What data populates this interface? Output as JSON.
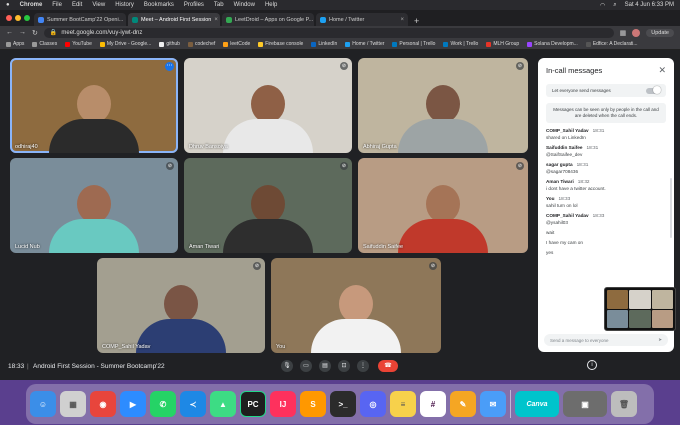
{
  "menubar": {
    "items": [
      "Chrome",
      "File",
      "Edit",
      "View",
      "History",
      "Bookmarks",
      "Profiles",
      "Tab",
      "Window",
      "Help"
    ],
    "clock": "Sat 4 Jun 6:33 PM"
  },
  "tabs": [
    {
      "label": "Summer BootCamp'22 Openi...",
      "color": "#4285f4"
    },
    {
      "label": "Meet – Android First Session",
      "color": "#00897b"
    },
    {
      "label": "LeetDroid – Apps on Google P...",
      "color": "#34a853"
    },
    {
      "label": "Home / Twitter",
      "color": "#1da1f2"
    }
  ],
  "address": {
    "url": "meet.google.com/vuy-iywt-dnz",
    "update_label": "Update"
  },
  "bookmarks": [
    "Apps",
    "Classes",
    "YouTube",
    "My Drive - Google...",
    "github",
    "codechef",
    "leetCode",
    "Firebase console",
    "LinkedIn",
    "Home / Twitter",
    "Personal | Trello",
    "Work | Trello",
    "MLH Group",
    "Solana Developm...",
    "Edfice: A Declarati..."
  ],
  "participants": [
    {
      "name": "odhiraj40",
      "skin": "#b88d6a",
      "shirt": "#2b2b2b",
      "bg": "#8e6b3f"
    },
    {
      "name": "Dhruv Bansoiya",
      "skin": "#8f6046",
      "shirt": "#e8e8e8",
      "bg": "#d6d2ca"
    },
    {
      "name": "Abhiraj Gupta",
      "skin": "#7b5644",
      "shirt": "#9da4a5",
      "bg": "#bfb59f"
    },
    {
      "name": "Lucid Nub",
      "skin": "#9e6a51",
      "shirt": "#69c9c1",
      "bg": "#7a8d9a"
    },
    {
      "name": "Aman Tiwari",
      "skin": "#6e4a35",
      "shirt": "#2e2e2e",
      "bg": "#5d6a5c"
    },
    {
      "name": "Saifuddin Saifee",
      "skin": "#a57457",
      "shirt": "#c0392b",
      "bg": "#b89c84"
    },
    {
      "name": "COMP_Sahil Yadav",
      "skin": "#7a5545",
      "shirt": "#2c3e73",
      "bg": "#a39f90"
    },
    {
      "name": "You",
      "skin": "#c7997c",
      "shirt": "#f2f2f2",
      "bg": "#8e7759"
    }
  ],
  "chat": {
    "title": "In-call messages",
    "toggle_label": "Let everyone send messages",
    "notice": "Messages can be seen only by people in the call and are deleted when the call ends.",
    "messages": [
      {
        "author": "COMP_Sahil Yadav",
        "time": "18:31",
        "lines": [
          "shared on LinkedIn"
        ]
      },
      {
        "author": "Saifuddin Saifee",
        "time": "18:31",
        "lines": [
          "@SaifSaifee_dev"
        ]
      },
      {
        "author": "sagar gupta",
        "time": "18:31",
        "lines": [
          "@sagar708436"
        ]
      },
      {
        "author": "Aman Tiwari",
        "time": "18:32",
        "lines": [
          "i dont have a twitter account."
        ]
      },
      {
        "author": "You",
        "time": "18:33",
        "lines": [
          "sahil turn on lol"
        ]
      },
      {
        "author": "COMP_Sahil Yadav",
        "time": "18:33",
        "lines": [
          "@ysahil03",
          "wait",
          "I have my cam on",
          "yes"
        ]
      }
    ],
    "send_placeholder": "Send a message to everyone"
  },
  "controls": {
    "time": "18:33",
    "meeting_title": "Android First Session - Summer Bootcamp'22"
  },
  "dock": [
    {
      "name": "finder",
      "color": "#3b8ee8",
      "glyph": "☺"
    },
    {
      "name": "launchpad",
      "color": "#d0d0d0",
      "glyph": "▦"
    },
    {
      "name": "chrome",
      "color": "#e8453c",
      "glyph": "◉"
    },
    {
      "name": "zoom",
      "color": "#2d8cff",
      "glyph": "▶"
    },
    {
      "name": "whatsapp",
      "color": "#25d366",
      "glyph": "✆"
    },
    {
      "name": "vscode",
      "color": "#1e88e5",
      "glyph": "≺"
    },
    {
      "name": "android-studio",
      "color": "#3ddc84",
      "glyph": "▲"
    },
    {
      "name": "pycharm",
      "color": "#1e1e1e",
      "glyph": "PC"
    },
    {
      "name": "intellij",
      "color": "#fe315d",
      "glyph": "IJ"
    },
    {
      "name": "sublime",
      "color": "#ff9800",
      "glyph": "S"
    },
    {
      "name": "terminal",
      "color": "#2b2b2b",
      "glyph": ">_"
    },
    {
      "name": "discord",
      "color": "#5865f2",
      "glyph": "◎"
    },
    {
      "name": "notes",
      "color": "#f7d14b",
      "glyph": "≡"
    },
    {
      "name": "slack",
      "color": "#ffffff",
      "glyph": "#"
    },
    {
      "name": "pages",
      "color": "#f5a623",
      "glyph": "✎"
    },
    {
      "name": "mail",
      "color": "#4a9df8",
      "glyph": "✉"
    },
    {
      "name": "canva",
      "color": "#00c4cc",
      "glyph": "Canva"
    },
    {
      "name": "preview",
      "color": "#6d6d6d",
      "glyph": "▣"
    },
    {
      "name": "trash",
      "color": "#bdbdbd",
      "glyph": "🗑"
    }
  ]
}
